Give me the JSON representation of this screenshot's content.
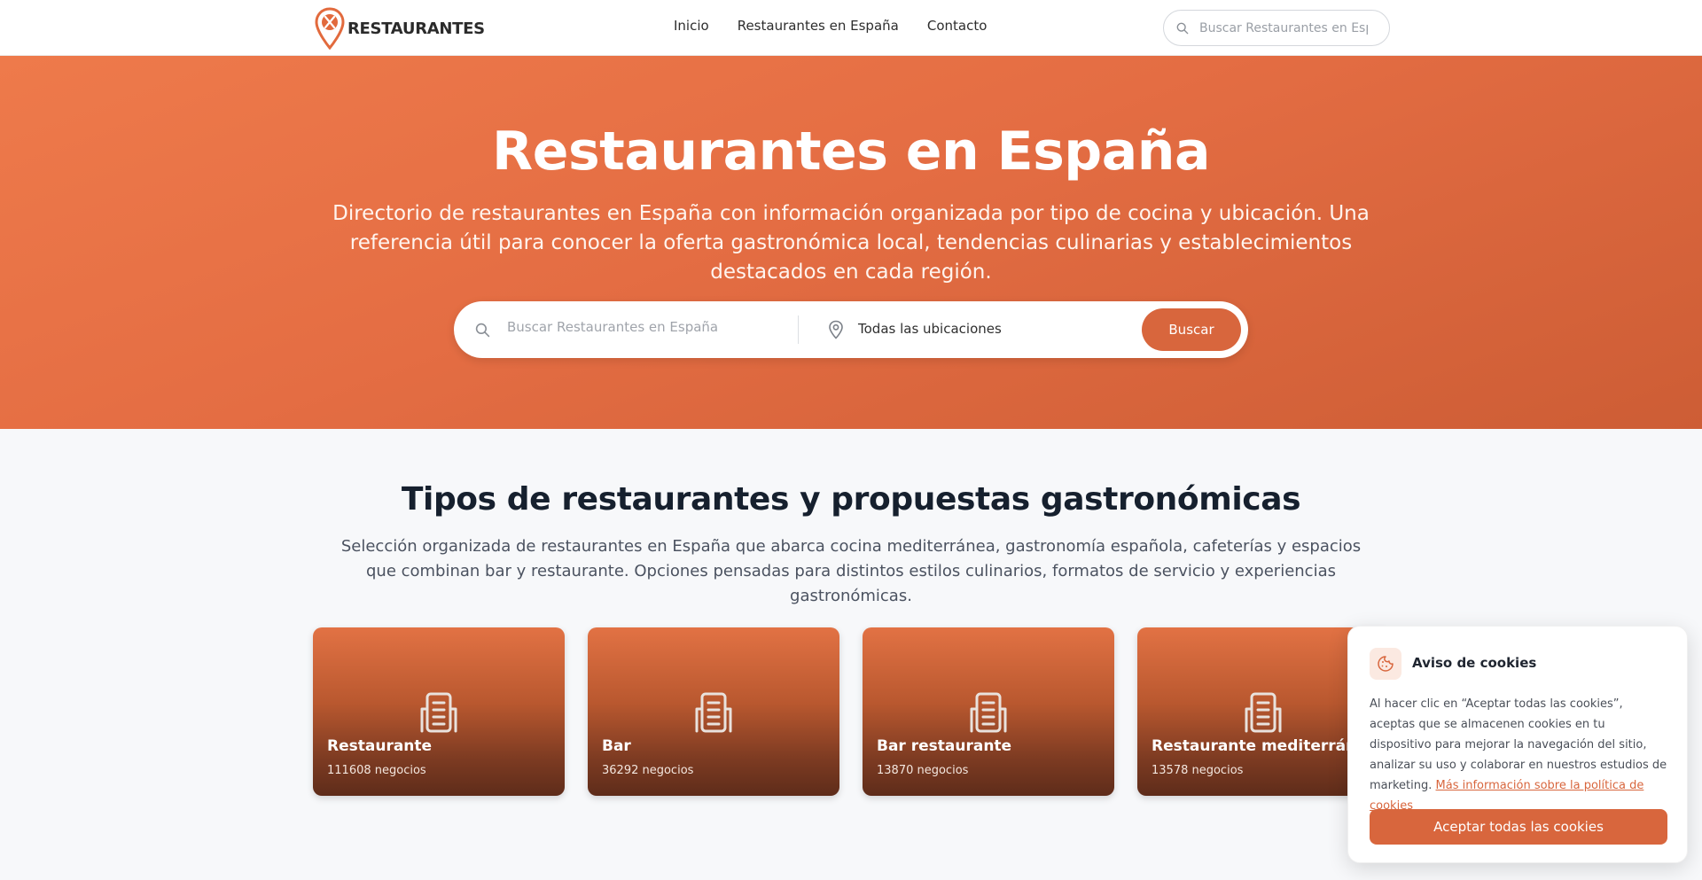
{
  "brand": {
    "name": "RESTAURANTES",
    "accent_color": "#d8663d"
  },
  "nav": {
    "links": [
      {
        "label": "Inicio"
      },
      {
        "label": "Restaurantes en España"
      },
      {
        "label": "Contacto"
      }
    ],
    "search": {
      "placeholder": "Buscar Restaurantes en España",
      "icon": "search-icon"
    }
  },
  "hero": {
    "title": "Restaurantes en España",
    "subtitle": "Directorio de restaurantes en España con información organizada por tipo de cocina y ubicación. Una referencia útil para conocer la oferta gastronómica local, tendencias culinarias y establecimientos destacados en cada región.",
    "search": {
      "placeholder": "Buscar Restaurantes en España",
      "location_value": "Todas las ubicaciones",
      "button_label": "Buscar"
    }
  },
  "categories": {
    "title": "Tipos de restaurantes y propuestas gastronómicas",
    "description": "Selección organizada de restaurantes en España que abarca cocina mediterránea, gastronomía española, cafeterías y espacios que combinan bar y restaurante. Opciones pensadas para distintos estilos culinarios, formatos de servicio y experiencias gastronómicas.",
    "items": [
      {
        "title": "Restaurante",
        "count": "111608 negocios",
        "icon": "building-icon"
      },
      {
        "title": "Bar",
        "count": "36292 negocios",
        "icon": "building-icon"
      },
      {
        "title": "Bar restaurante",
        "count": "13870 negocios",
        "icon": "building-icon"
      },
      {
        "title": "Restaurante mediterráneo",
        "count": "13578 negocios",
        "icon": "building-icon"
      }
    ]
  },
  "cookie_notice": {
    "title": "Aviso de cookies",
    "text": "Al hacer clic en “Aceptar todas las cookies”, aceptas que se almacenen cookies en tu dispositivo para mejorar la navegación del sitio, analizar su uso y colaborar en nuestros estudios de marketing.",
    "link_label": "Más información sobre la política de cookies",
    "accept_label": "Aceptar todas las cookies",
    "icon": "cookie-icon"
  }
}
